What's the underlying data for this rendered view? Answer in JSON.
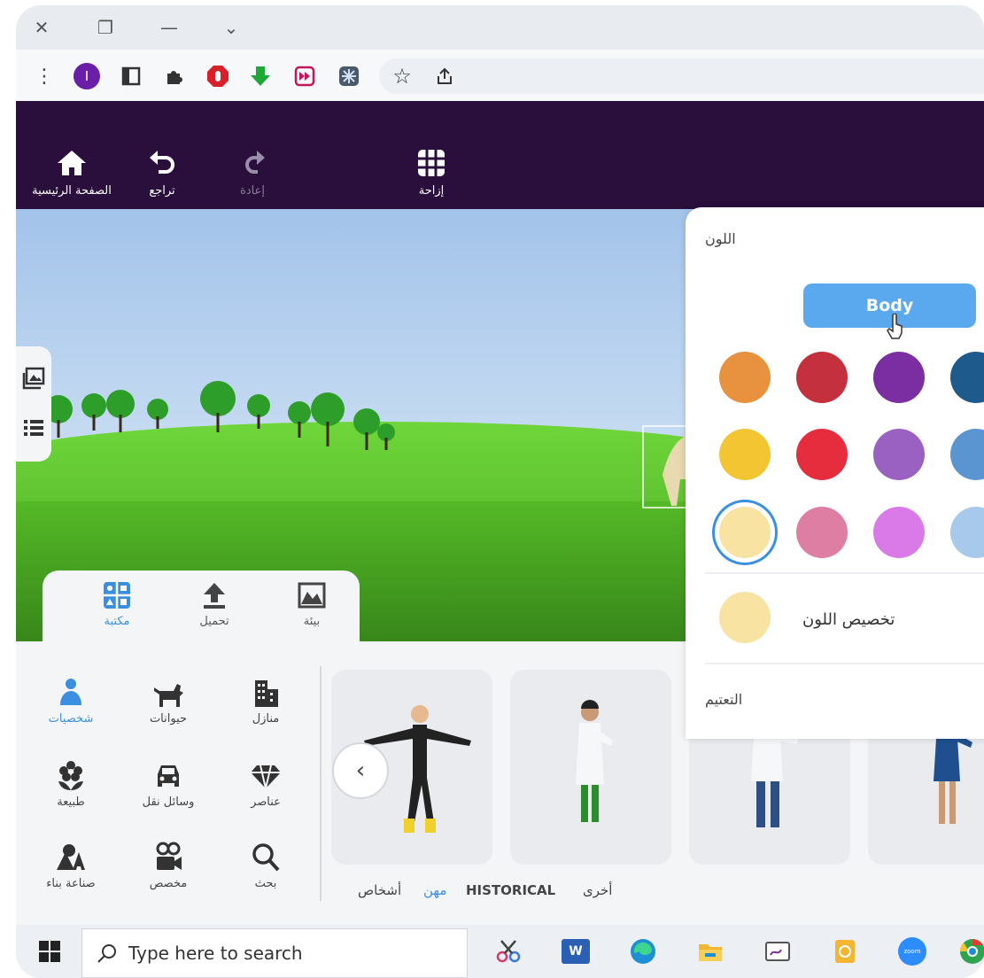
{
  "window": {
    "close_glyph": "✕",
    "restore_glyph": "❐",
    "minimize_glyph": "—",
    "menu_glyph": "⌄"
  },
  "browser": {
    "menu_glyph": "⋮",
    "profile_letter": "I",
    "star_glyph": "☆"
  },
  "appbar": {
    "home_label": "الصفحة الرئيسية",
    "undo_label": "تراجع",
    "redo_label": "إعادة",
    "shift_label": "إزاحة"
  },
  "library_tabs": [
    {
      "label": "مكتبة",
      "icon": "library-icon",
      "active": true
    },
    {
      "label": "تحميل",
      "icon": "upload-icon",
      "active": false
    },
    {
      "label": "بيئة",
      "icon": "environment-icon",
      "active": false
    }
  ],
  "categories": [
    {
      "label": "شخصيات",
      "icon": "person-icon",
      "active": true
    },
    {
      "label": "حيوانات",
      "icon": "dog-icon",
      "active": false
    },
    {
      "label": "منازل",
      "icon": "buildings-icon",
      "active": false
    },
    {
      "label": "طبيعة",
      "icon": "flower-icon",
      "active": false
    },
    {
      "label": "وسائل نقل",
      "icon": "car-icon",
      "active": false
    },
    {
      "label": "عناصر",
      "icon": "diamond-icon",
      "active": false
    },
    {
      "label": "صناعة بناء",
      "icon": "build-icon",
      "active": false
    },
    {
      "label": "مخصص",
      "icon": "camera-icon",
      "active": false
    },
    {
      "label": "بحث",
      "icon": "search-icon",
      "active": false
    }
  ],
  "sub_tabs": [
    {
      "label": "أشخاص",
      "active": false
    },
    {
      "label": "مهن",
      "active": true
    },
    {
      "label": "HISTORICAL",
      "active": false
    },
    {
      "label": "أخرى",
      "active": false
    }
  ],
  "prev_glyph": "‹",
  "color_panel": {
    "title": "اللون",
    "body_button": "Body",
    "swatches": [
      [
        "#e8913f",
        "#c4303e",
        "#7b2ea1",
        "#1f5a8c"
      ],
      [
        "#f3c533",
        "#e52d3e",
        "#9a60c2",
        "#5a95d1"
      ],
      [
        "#f9e3a2",
        "#de7ea3",
        "#d97ae8",
        "#a6c9ec"
      ]
    ],
    "selected_swatch": "#f9e3a2",
    "custom_color_label": "تخصيص اللون",
    "custom_color": "#f9e3a2",
    "shading_label": "التعتيم"
  },
  "taskbar": {
    "search_placeholder": "Type here to search",
    "word_letter": "W",
    "zoom_label": "zoom"
  }
}
